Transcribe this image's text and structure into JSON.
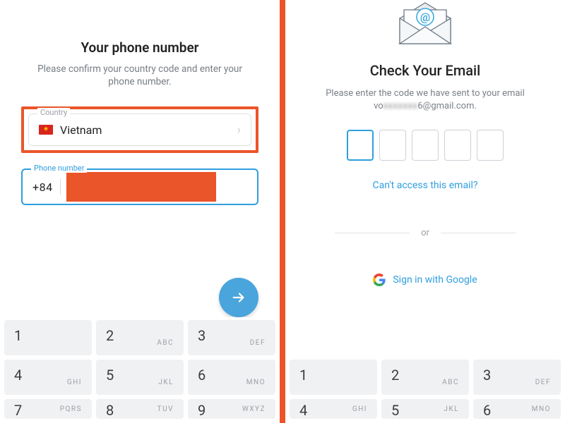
{
  "left": {
    "title": "Your phone number",
    "subtitle": "Please confirm your country code and enter your phone number.",
    "country_legend": "Country",
    "country_name": "Vietnam",
    "phone_legend": "Phone number",
    "phone_code": "+84"
  },
  "right": {
    "title": "Check Your Email",
    "sub_prefix": "Please enter the code we have sent to your email ",
    "email_vis_prefix": "vo",
    "email_blur": "xxxxxxx",
    "email_vis_suffix": "6@gmail.com.",
    "cant_access": "Can't access this email?",
    "or": "or",
    "google": "Sign in with Google"
  },
  "keypad": {
    "r1": [
      {
        "d": "1",
        "l": ""
      },
      {
        "d": "2",
        "l": "ABC"
      },
      {
        "d": "3",
        "l": "DEF"
      }
    ],
    "r2": [
      {
        "d": "4",
        "l": "GHI"
      },
      {
        "d": "5",
        "l": "JKL"
      },
      {
        "d": "6",
        "l": "MNO"
      }
    ],
    "r3": [
      {
        "d": "7",
        "l": "PQRS"
      },
      {
        "d": "8",
        "l": "TUV"
      },
      {
        "d": "9",
        "l": "WXYZ"
      }
    ]
  }
}
